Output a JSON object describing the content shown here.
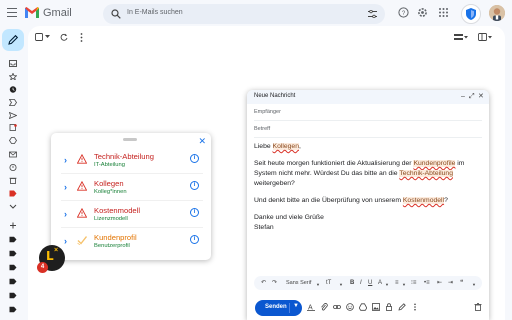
{
  "app": {
    "name": "Gmail"
  },
  "search": {
    "placeholder": "In E-Mails suchen"
  },
  "compose": {
    "title": "Neue Nachricht",
    "to_label": "Empfänger",
    "subject_label": "Betreff",
    "body": {
      "greeting_prefix": "Liebe ",
      "greeting_word": "Kollegen",
      "greeting_suffix": ",",
      "p1_a": "Seit heute morgen funktioniert die Aktualisierung der ",
      "p1_word1": "Kundenprofile",
      "p1_b": " im System nicht mehr. Würdest Du das bitte an die ",
      "p1_word2": "Technik-Abteilung",
      "p1_c": " weitergeben?",
      "p2_a": "Und denkt bitte an die Überprüfung von unserem ",
      "p2_word": "Kostenmodell",
      "p2_b": "?",
      "closing": "Danke und viele Grüße",
      "signature": "Stefan"
    },
    "font_name": "Sans Serif",
    "send_label": "Senden"
  },
  "panel": {
    "items": [
      {
        "title": "Technik-Abteilung",
        "suggestion": "IT-Abteilung",
        "severity": "error"
      },
      {
        "title": "Kollegen",
        "suggestion": "Kolleg*innen",
        "severity": "error"
      },
      {
        "title": "Kostenmodell",
        "suggestion": "Lizenzmodell",
        "severity": "error"
      },
      {
        "title": "Kundenprofil",
        "suggestion": "Benutzerprofil",
        "severity": "ok"
      }
    ]
  },
  "badge": {
    "count": "4"
  },
  "colors": {
    "accent": "#1a73e8",
    "error": "#c5221f",
    "send": "#0b57d0"
  }
}
